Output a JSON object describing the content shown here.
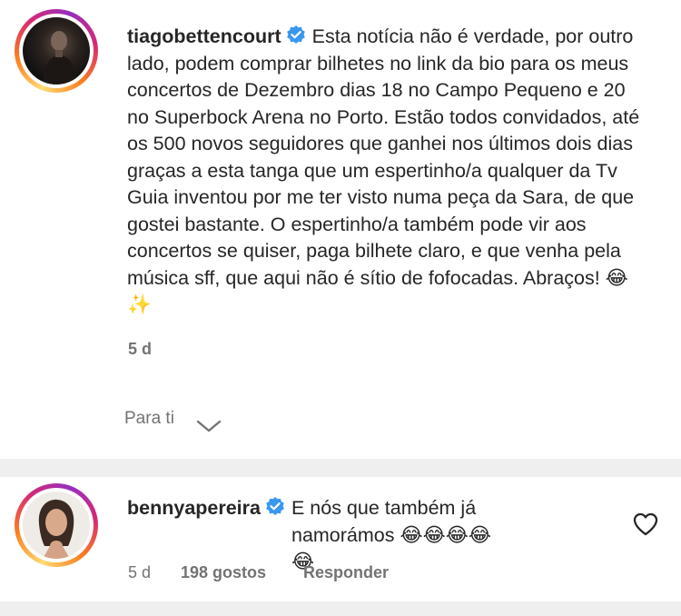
{
  "comments": [
    {
      "username": "tiagobettencourt",
      "verified": true,
      "text": "Esta notícia não é verdade, por outro lado, podem comprar bilhetes no link da bio para os meus concertos de Dezembro dias 18 no Campo Pequeno e 20 no Superbock Arena no Porto. Estão todos convidados, até os 500 novos seguidores que ganhei nos últimos dois dias graças a esta tanga que um espertinho/a qualquer da Tv Guia inventou por me ter visto numa peça da Sara, de que gostei bastante. O espertinho/a também pode vir aos concertos se quiser, paga bilhete claro, e que venha pela música sff, que aqui não é sítio de fofocadas. Abraços! 😂✨",
      "time": "5 d",
      "filter_label": "Para ti"
    },
    {
      "username": "bennyapereira",
      "verified": true,
      "text": "E nós que também já namorámos 😂😂😂😂😂",
      "time": "5 d",
      "likes": "198 gostos",
      "reply_label": "Responder"
    }
  ],
  "colors": {
    "verified_blue": "#3897f0",
    "meta_gray": "#737373",
    "divider": "#efefef"
  },
  "icons": [
    "verified-badge-icon",
    "chevron-down-icon",
    "heart-icon"
  ]
}
